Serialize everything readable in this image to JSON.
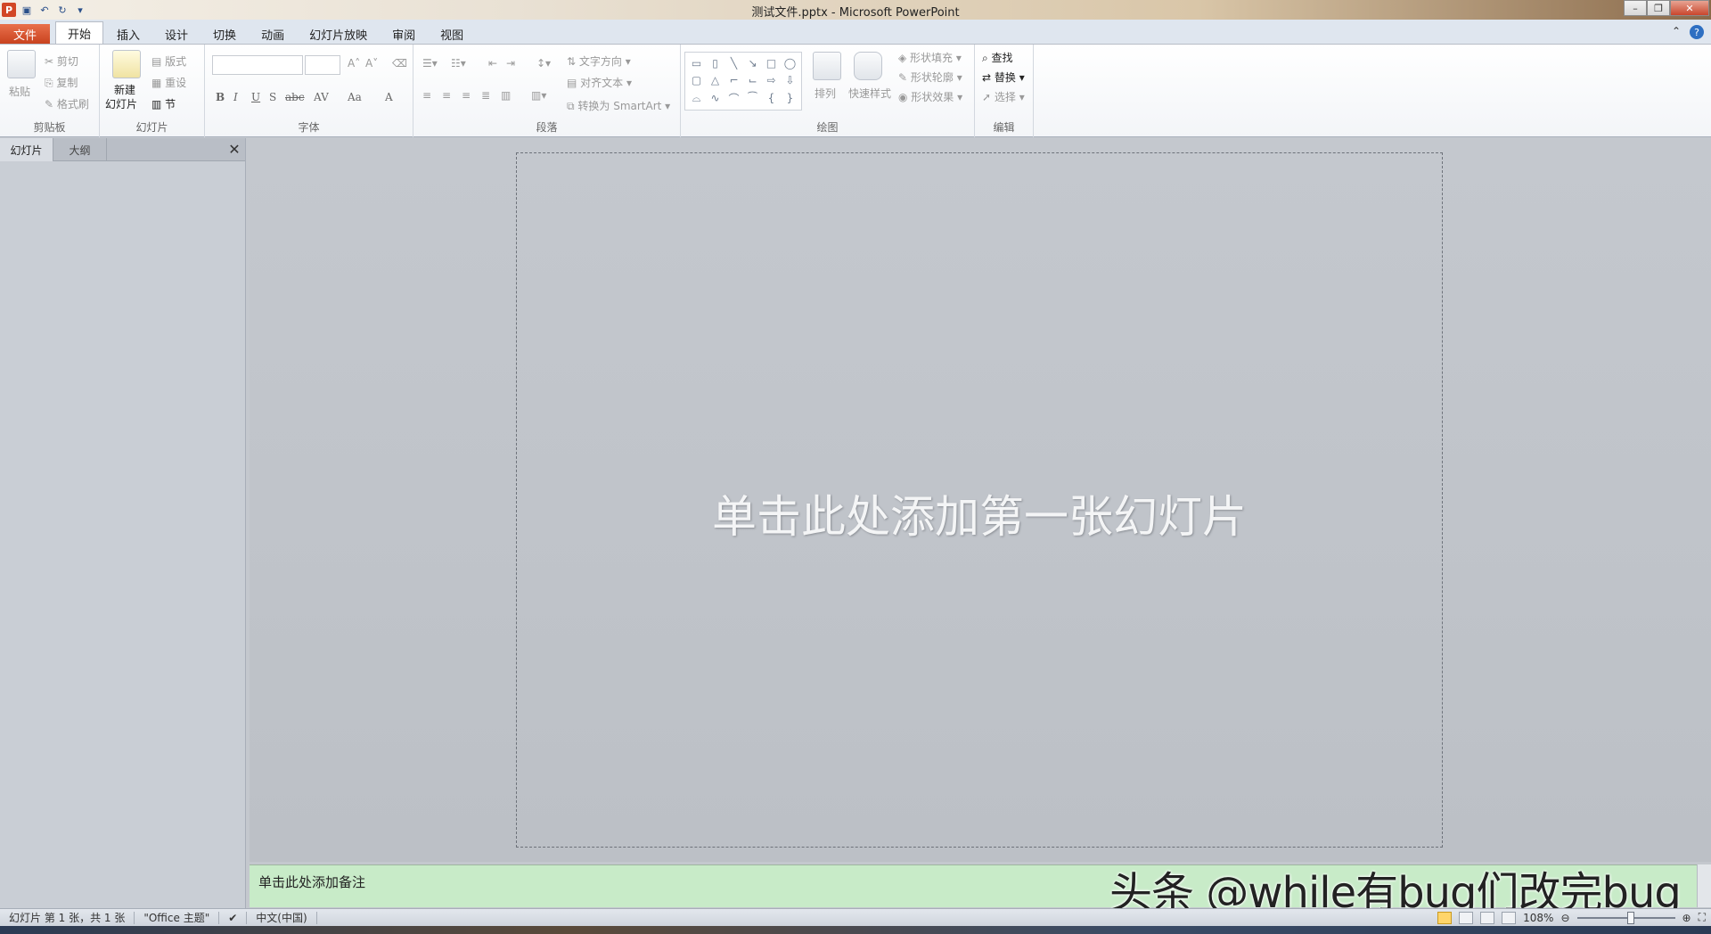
{
  "window": {
    "title": "测试文件.pptx - Microsoft PowerPoint"
  },
  "qat": {
    "icons": [
      "powerpoint-icon",
      "save-icon",
      "undo-icon",
      "redo-icon",
      "customize-icon"
    ]
  },
  "tabs": {
    "file": "文件",
    "items": [
      "开始",
      "插入",
      "设计",
      "切换",
      "动画",
      "幻灯片放映",
      "审阅",
      "视图"
    ],
    "active": "开始"
  },
  "ribbon": {
    "clipboard": {
      "label": "剪贴板",
      "paste": "粘贴",
      "cut": "剪切",
      "copy": "复制",
      "format_painter": "格式刷"
    },
    "slides": {
      "label": "幻灯片",
      "new_slide_1": "新建",
      "new_slide_2": "幻灯片",
      "layout": "版式",
      "reset": "重设",
      "section": "节"
    },
    "font": {
      "label": "字体",
      "bold": "B",
      "italic": "I",
      "underline": "U",
      "strike": "S",
      "abc": "abc",
      "spacing": "AV",
      "case": "Aa",
      "color": "A"
    },
    "paragraph": {
      "label": "段落",
      "text_direction": "文字方向",
      "align_text": "对齐文本",
      "smartart": "转换为 SmartArt"
    },
    "drawing": {
      "label": "绘图",
      "arrange": "排列",
      "quick_styles": "快速样式",
      "shape_fill": "形状填充",
      "shape_outline": "形状轮廓",
      "shape_effects": "形状效果"
    },
    "editing": {
      "label": "编辑",
      "find": "查找",
      "replace": "替换",
      "select": "选择"
    }
  },
  "left_panel": {
    "tabs": [
      "幻灯片",
      "大纲"
    ],
    "close": "✕"
  },
  "slide": {
    "placeholder": "单击此处添加第一张幻灯片"
  },
  "notes": {
    "placeholder": "单击此处添加备注"
  },
  "watermark": "头条 @while有bug们改完bug",
  "status": {
    "slide_info": "幻灯片 第 1 张，共 1 张",
    "theme": "\"Office 主题\"",
    "language": "中文(中国)",
    "zoom": "108%"
  }
}
